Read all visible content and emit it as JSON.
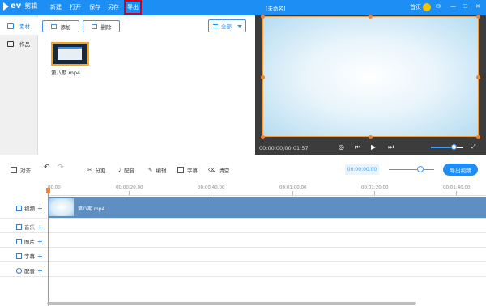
{
  "app": {
    "logo_text": "ev",
    "logo_cn": "剪辑",
    "window_title": "[未命名]",
    "menu": [
      "新建",
      "打开",
      "保存",
      "另存",
      "导出"
    ],
    "active_menu_index": 4,
    "titlebar_right": {
      "home": "首页"
    }
  },
  "left_tabs": [
    {
      "label": "素材",
      "active": true
    },
    {
      "label": "作品",
      "active": false
    }
  ],
  "media_panel": {
    "add_label": "添加",
    "delete_label": "删除",
    "filter_value": "全部",
    "items": [
      {
        "name": "第八期.mp4"
      }
    ]
  },
  "preview": {
    "timecode": "00:00:00/00:01:57",
    "volume_fraction": 0.7
  },
  "toolbar": {
    "align_label": "对齐",
    "split_label": "分割",
    "dub_label": "配音",
    "edit_label": "编辑",
    "subtitle_label": "字幕",
    "clear_label": "清空",
    "time_display": "00:00:00.00",
    "export_label": "导出视频",
    "zoom_fraction": 0.7
  },
  "timeline": {
    "ticks": [
      "00.00",
      "00:00:20.00",
      "00:00:40.00",
      "00:01:00.00",
      "00:01:20.00",
      "00:01:40.00"
    ],
    "tracks": [
      {
        "label": "视频",
        "icon": "video-icon"
      },
      {
        "label": "音乐",
        "icon": "music-icon"
      },
      {
        "label": "图片",
        "icon": "image-icon"
      },
      {
        "label": "字幕",
        "icon": "subtitle-icon"
      },
      {
        "label": "配音",
        "icon": "mic-icon"
      }
    ],
    "clip_name": "第八期.mp4"
  },
  "colors": {
    "accent": "#1d8ef3",
    "highlight": "#d0021b",
    "clip": "#5f8fc2"
  }
}
